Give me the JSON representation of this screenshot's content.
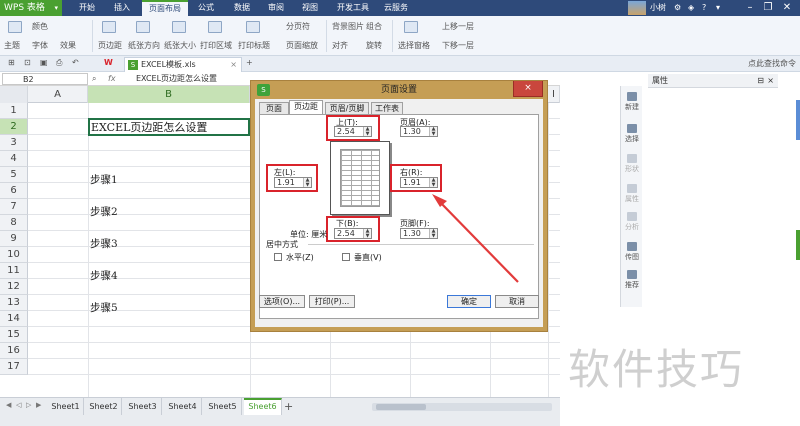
{
  "menubar": {
    "app_label": "WPS 表格",
    "tabs": [
      "开始",
      "插入",
      "页面布局",
      "公式",
      "数据",
      "审阅",
      "视图",
      "开发工具",
      "云服务"
    ],
    "active_tab": "页面布局",
    "user_name": "小树"
  },
  "toolbar": {
    "theme": "主题",
    "colors": "颜色",
    "fonts": "字体",
    "effects": "效果",
    "margins": "页边距",
    "orientation": "纸张方向",
    "size": "纸张大小",
    "print_area": "打印区域",
    "print_titles": "打印标题",
    "page_zoom": "页面缩放",
    "page_breaks": "分页符",
    "background": "背景图片",
    "group": "组合",
    "align": "对齐",
    "rotate": "旋转",
    "selection_pane": "选择窗格",
    "bring_forward": "上移一层",
    "send_backward": "下移一层"
  },
  "docbar": {
    "file_name": "EXCEL模板.xls",
    "search_hint": "点此查找命令"
  },
  "formula": {
    "cell_ref": "B2",
    "fx": "fx",
    "value": "EXCEL页边距怎么设置"
  },
  "grid": {
    "columns": [
      "A",
      "B",
      "I"
    ],
    "rows": [
      "1",
      "2",
      "3",
      "4",
      "5",
      "6",
      "7",
      "8",
      "9",
      "10",
      "11",
      "12",
      "13",
      "14",
      "15",
      "16",
      "17"
    ],
    "cells": {
      "b2": "EXCEL页边距怎么设置",
      "b5": "步骤1",
      "b7": "步骤2",
      "b9": "步骤3",
      "b11": "步骤4",
      "b13": "步骤5"
    }
  },
  "sheets": [
    "Sheet1",
    "Sheet2",
    "Sheet3",
    "Sheet4",
    "Sheet5",
    "Sheet6"
  ],
  "active_sheet": "Sheet6",
  "add_sheet": "+",
  "panel": {
    "title": "属性",
    "items": [
      "新建",
      "选择",
      "形状",
      "属性",
      "分析",
      "传图",
      "推荐"
    ]
  },
  "watermark": "软件技巧",
  "dialog": {
    "title": "页面设置",
    "close": "×",
    "tabs": [
      "页面",
      "页边距",
      "页眉/页脚",
      "工作表"
    ],
    "active_tab": "页边距",
    "top_label": "上(T):",
    "top_value": "2.54",
    "header_label": "页眉(A):",
    "header_value": "1.30",
    "left_label": "左(L):",
    "left_value": "1.91",
    "right_label": "右(R):",
    "right_value": "1.91",
    "bottom_label": "下(B):",
    "bottom_value": "2.54",
    "footer_label": "页脚(F):",
    "footer_value": "1.30",
    "unit_label": "单位: 厘米",
    "center_label": "居中方式",
    "horizontal": "水平(Z)",
    "vertical": "垂直(V)",
    "options_btn": "选项(O)...",
    "print_btn": "打印(P)...",
    "ok_btn": "确定",
    "cancel_btn": "取消"
  },
  "colors": {
    "accent_green": "#4aa031",
    "menubar_blue": "#2e4a7a",
    "highlight_red": "#d9232b",
    "dialog_frame": "#c59e55"
  }
}
